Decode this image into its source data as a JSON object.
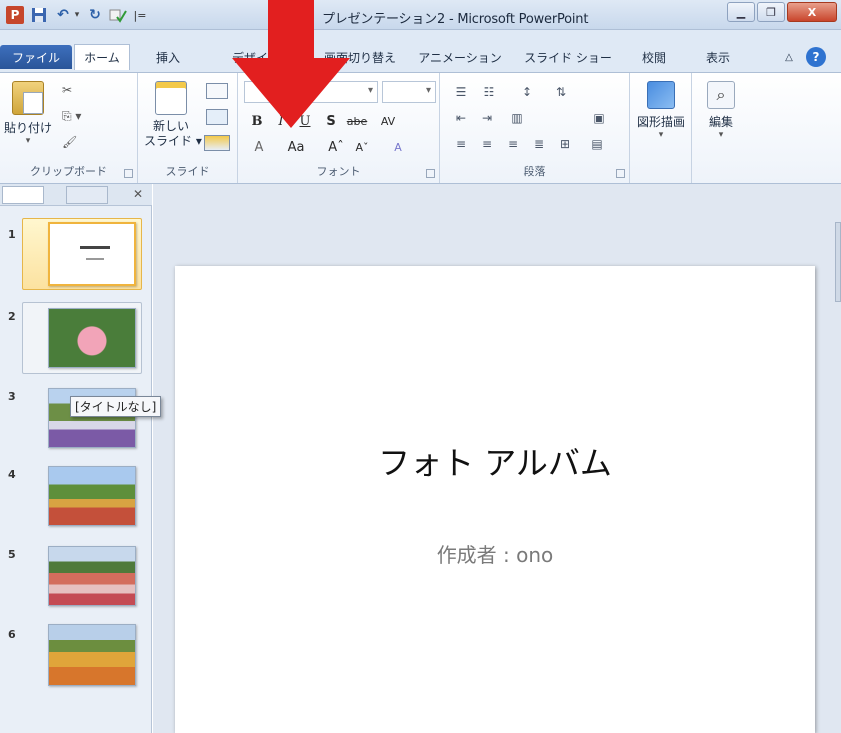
{
  "window": {
    "title": "プレゼンテーション2 - Microsoft PowerPoint",
    "close_glyph": "X"
  },
  "quick_access": {
    "app_icon_label": "P",
    "customize_glyph": "|="
  },
  "tabs": [
    {
      "label": "ファイル"
    },
    {
      "label": "ホーム"
    },
    {
      "label": "挿入"
    },
    {
      "label": "デザイン"
    },
    {
      "label": "画面切り替え"
    },
    {
      "label": "アニメーション"
    },
    {
      "label": "スライド ショー"
    },
    {
      "label": "校閲"
    },
    {
      "label": "表示"
    }
  ],
  "ribbon": {
    "clipboard": {
      "paste_label": "貼り付け",
      "group_label": "クリップボード"
    },
    "slides": {
      "new_slide_label_line1": "新しい",
      "new_slide_label_line2": "スライド ▾",
      "group_label": "スライド"
    },
    "font": {
      "group_label": "フォント",
      "bold": "B",
      "italic": "I",
      "underline": "U",
      "shadow": "S",
      "strike": "abe",
      "spacing": "AV",
      "font_color": "A",
      "change_case": "Aa",
      "grow": "Aˆ",
      "shrink": "Aˇ",
      "clear_formatting": "A"
    },
    "paragraph": {
      "group_label": "段落"
    },
    "drawing": {
      "label": "図形描画"
    },
    "editing": {
      "label": "編集"
    }
  },
  "slides_pane": {
    "tooltip": "[タイトルなし]",
    "slides": [
      {
        "number": "1"
      },
      {
        "number": "2"
      },
      {
        "number": "3"
      },
      {
        "number": "4"
      },
      {
        "number": "5"
      },
      {
        "number": "6"
      }
    ]
  },
  "slide": {
    "title": "フォト アルバム",
    "subtitle": "作成者 : ono"
  },
  "colors": {
    "file_tab": "#2a5599",
    "arrow": "#e02020",
    "selected_slide": "#f0b43d"
  }
}
